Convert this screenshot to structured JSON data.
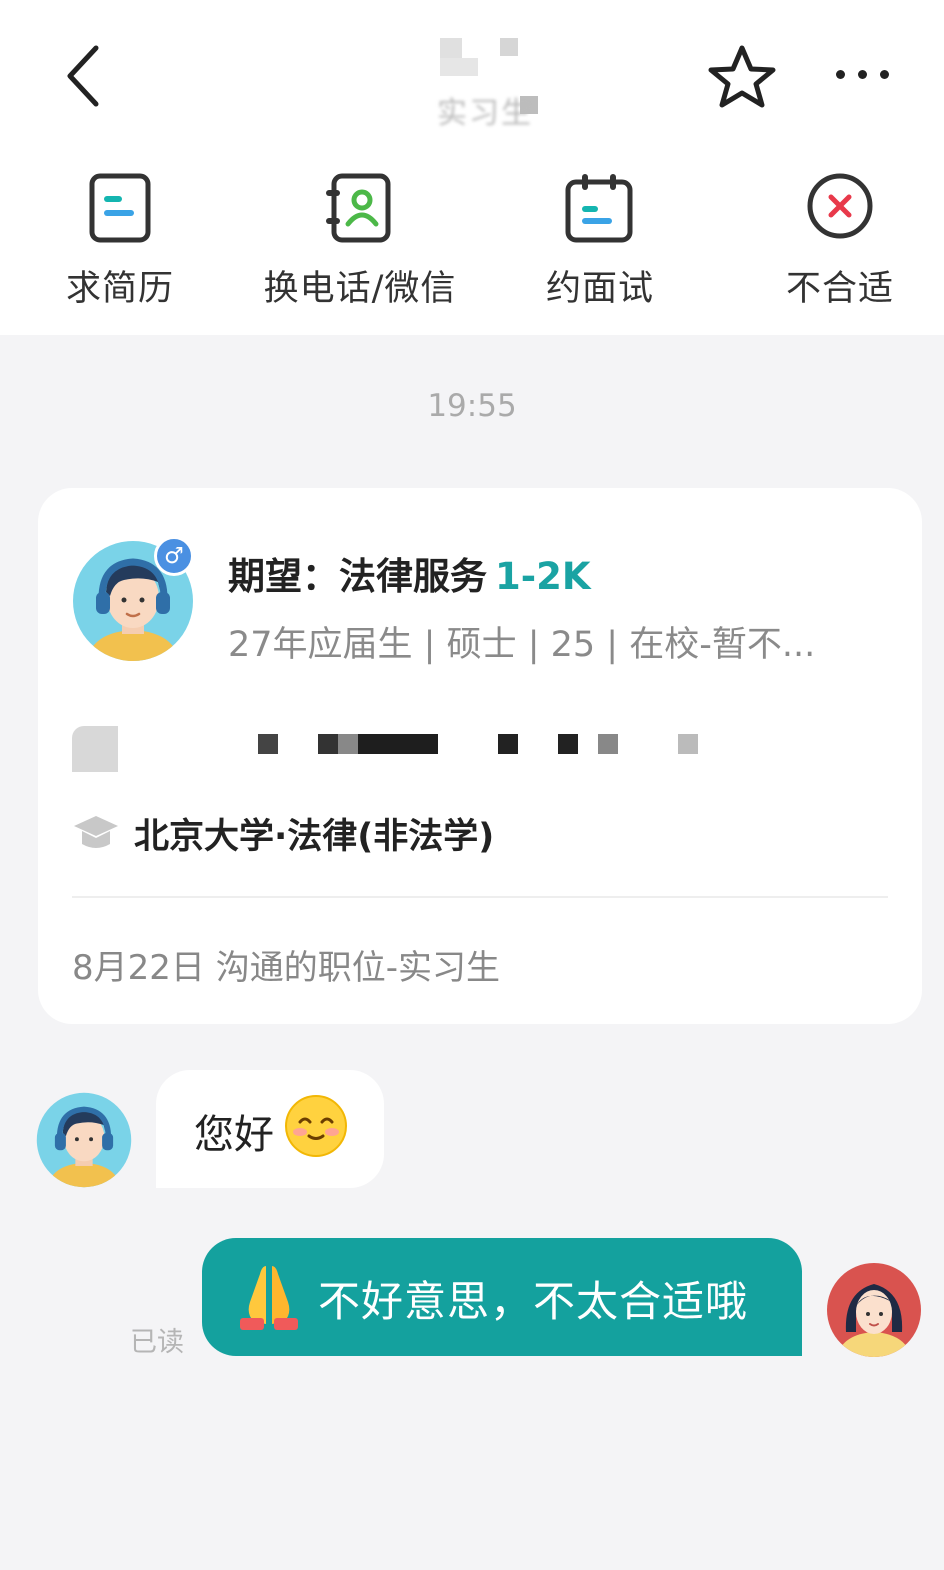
{
  "header": {
    "title_redacted": "",
    "subtitle": "实习生",
    "back_icon": "chevron-left-icon",
    "star_icon": "star-outline-icon",
    "more_icon": "more-dots-icon"
  },
  "actions": [
    {
      "label": "求简历",
      "icon": "resume-icon"
    },
    {
      "label": "换电话/微信",
      "icon": "contact-card-icon"
    },
    {
      "label": "约面试",
      "icon": "calendar-icon"
    },
    {
      "label": "不合适",
      "icon": "reject-x-icon"
    }
  ],
  "chat": {
    "timestamp": "19:55",
    "candidate_card": {
      "expect_label": "期望：法律服务",
      "salary": "1-2K",
      "meta": "27年应届生 | 硕士 | 25 | 在校-暂不...",
      "school": "北京大学·法律(非法学)",
      "job_line": "8月22日 沟通的职位-实习生",
      "gender": "♂"
    },
    "messages": [
      {
        "side": "left",
        "text": "您好",
        "emoji": "smiling-blush-emoji"
      },
      {
        "side": "right",
        "text": "不好意思，不太合适哦",
        "emoji": "praying-hands-emoji",
        "status": "已读"
      }
    ]
  },
  "colors": {
    "accent": "#14a19e",
    "salary": "#1aa3a3",
    "reject": "#e8394a",
    "badge": "#4a90e2"
  }
}
